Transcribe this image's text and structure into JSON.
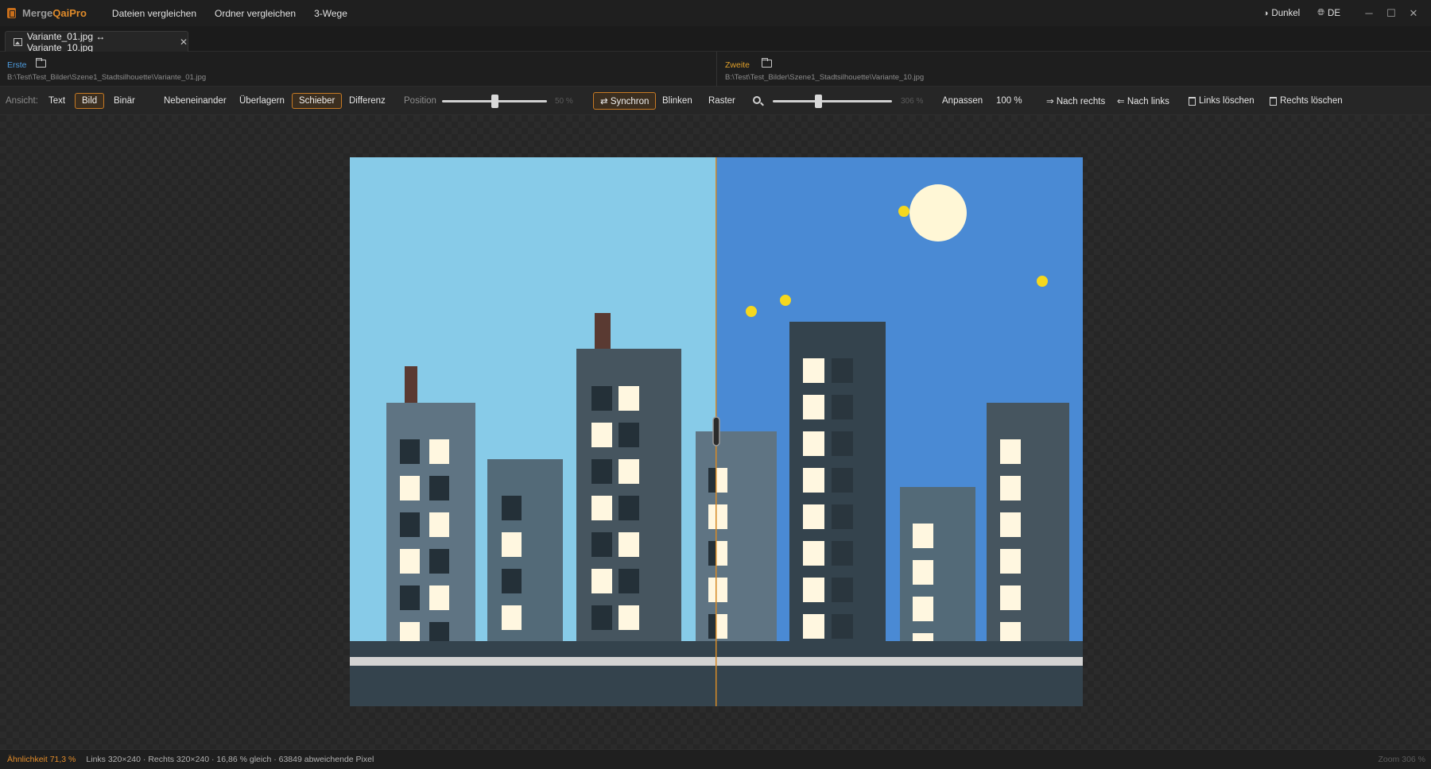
{
  "app": {
    "name_a": "Merge",
    "name_b": "QaiPro"
  },
  "menu": {
    "compare_files": "Dateien vergleichen",
    "compare_folders": "Ordner vergleichen",
    "three_way": "3-Wege"
  },
  "titlebar": {
    "theme_label": "Dunkel",
    "language_label": "DE",
    "minimize": "─",
    "maximize": "☐",
    "close": "✕"
  },
  "tab": {
    "title": "Variante_01.jpg ↔ Variante_10.jpg",
    "close": "✕"
  },
  "left_file": {
    "label": "Erste",
    "path": "B:\\Test\\Test_Bilder\\Szene1_Stadtsilhouette\\Variante_01.jpg",
    "label_color": "#4e9de0"
  },
  "right_file": {
    "label": "Zweite",
    "path": "B:\\Test\\Test_Bilder\\Szene1_Stadtsilhouette\\Variante_10.jpg",
    "label_color": "#e0a02a"
  },
  "toolbar": {
    "view_label": "Ansicht:",
    "view_text": "Text",
    "view_image": "Bild",
    "view_binary": "Binär",
    "mode_side": "Nebeneinander",
    "mode_overlay": "Überlagern",
    "mode_slider": "Schieber",
    "mode_diff": "Differenz",
    "position_label": "Position",
    "position_value": "50 %",
    "position_fraction": 0.5,
    "sync_label": "⇄ Synchron",
    "blink_label": "Blinken",
    "grid_label": "Raster",
    "zoom_value": "306 %",
    "zoom_fraction": 0.38,
    "fit_label": "Anpassen",
    "hundred_label": "100 %",
    "copy_right": "⇒ Nach rechts",
    "copy_left": "⇐ Nach links",
    "delete_left": "Links löschen",
    "delete_right": "Rechts löschen"
  },
  "icons": {
    "theme": "contrast-icon",
    "language": "globe-icon",
    "tab": "image-icon",
    "folder": "folder-open-icon",
    "zoom": "magnifier-icon",
    "delete": "trash-icon"
  },
  "scene_colors": {
    "sky_left": "#87cbe8",
    "sky_right": "#4a8ad4",
    "moon": "#fff7d6",
    "star": "#f5d81e",
    "divider": "#d48a28"
  },
  "status": {
    "similarity": "Ähnlichkeit 71,3 %",
    "info": "Links 320×240 · Rechts 320×240 · 16,86 % gleich · 63849 abweichende Pixel",
    "zoom": "Zoom 306 %"
  }
}
